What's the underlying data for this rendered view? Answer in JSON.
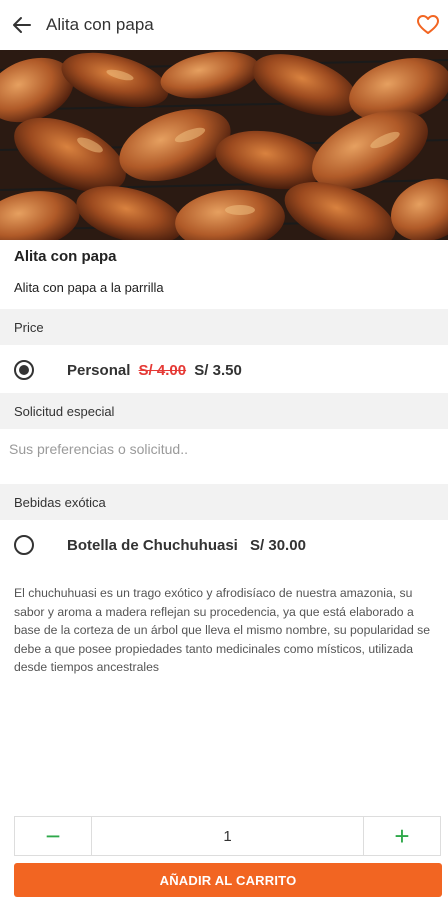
{
  "header": {
    "title": "Alita con papa",
    "back_icon": "arrow-left-icon",
    "favorite_icon": "heart-outline-icon",
    "favorite_color": "#f26522"
  },
  "product": {
    "name": "Alita con papa",
    "description": "Alita con papa a la parrilla",
    "image": "grilled-chicken-wings"
  },
  "price_section": {
    "title": "Price",
    "options": [
      {
        "label": "Personal",
        "old_price": "S/ 4.00",
        "price": "S/ 3.50",
        "selected": true
      }
    ]
  },
  "special_request": {
    "title": "Solicitud especial",
    "placeholder": "Sus preferencias o solicitud.."
  },
  "drinks_section": {
    "title": "Bebidas exótica",
    "options": [
      {
        "label": "Botella de Chuchuhuasi",
        "price": "S/ 30.00",
        "selected": false
      }
    ],
    "info": "El chuchuhuasi es un trago exótico y afrodisíaco de nuestra amazonia, su sabor y aroma a madera reflejan su procedencia, ya que está elaborado a base de la corteza de un árbol que lleva el mismo nombre, su popularidad se debe a que posee propiedades tanto medicinales como místicos, utilizada desde tiempos ancestrales"
  },
  "quantity": {
    "value": "1",
    "minus": "−",
    "plus": "+"
  },
  "cart_button": {
    "label": "AÑADIR AL CARRITO"
  },
  "colors": {
    "accent": "#f26522",
    "green": "#2ea84a",
    "strike": "#e53935",
    "section_bg": "#f2f2f2"
  }
}
